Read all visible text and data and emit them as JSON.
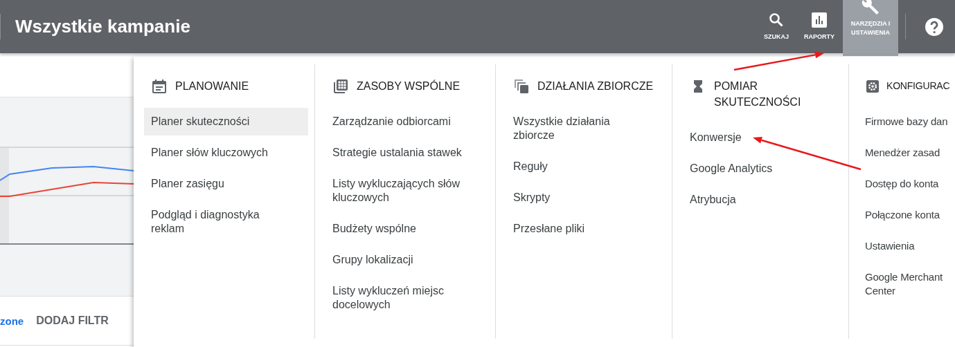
{
  "header": {
    "title": "Wszystkie kampanie",
    "actions": [
      {
        "kind": "search",
        "label": "SZUKAJ",
        "selected": false
      },
      {
        "kind": "reports",
        "label": "RAPORTY",
        "selected": false
      },
      {
        "kind": "tools",
        "label": "NARZĘDZIA I USTAWIENIA",
        "selected": true
      }
    ]
  },
  "filter_bar": {
    "link": "zone",
    "button": "DODAJ FILTR"
  },
  "menu": {
    "columns": [
      {
        "kind": "calendar",
        "heading": "PLANOWANIE",
        "items": [
          {
            "label": "Planer skuteczności",
            "selected": true
          },
          {
            "label": "Planer słów kluczowych",
            "selected": false
          },
          {
            "label": "Planer zasięgu",
            "selected": false
          },
          {
            "label": "Podgląd i diagnostyka reklam",
            "selected": false
          }
        ]
      },
      {
        "kind": "grid",
        "heading": "ZASOBY WSPÓLNE",
        "items": [
          {
            "label": "Zarządzanie odbiorcami",
            "selected": false
          },
          {
            "label": "Strategie ustalania stawek",
            "selected": false
          },
          {
            "label": "Listy wykluczających słów kluczowych",
            "selected": false
          },
          {
            "label": "Budżety wspólne",
            "selected": false
          },
          {
            "label": "Grupy lokalizacji",
            "selected": false
          },
          {
            "label": "Listy wykluczeń miejsc docelowych",
            "selected": false
          }
        ]
      },
      {
        "kind": "copies",
        "heading": "DZIAŁANIA ZBIORCZE",
        "items": [
          {
            "label": "Wszystkie działania zbiorcze",
            "selected": false
          },
          {
            "label": "Reguły",
            "selected": false
          },
          {
            "label": "Skrypty",
            "selected": false
          },
          {
            "label": "Przesłane pliki",
            "selected": false
          }
        ]
      },
      {
        "kind": "hourglass",
        "heading": "POMIAR SKUTECZNOŚCI",
        "items": [
          {
            "label": "Konwersje",
            "selected": false
          },
          {
            "label": "Google Analytics",
            "selected": false
          },
          {
            "label": "Atrybucja",
            "selected": false
          }
        ]
      },
      {
        "kind": "gear",
        "heading": "KONFIGURAC",
        "items": [
          {
            "label": "Firmowe bazy dan",
            "selected": false
          },
          {
            "label": "Menedżer zasad",
            "selected": false
          },
          {
            "label": "Dostęp do konta",
            "selected": false
          },
          {
            "label": "Połączone konta",
            "selected": false
          },
          {
            "label": "Ustawienia",
            "selected": false
          },
          {
            "label": "Google Merchant Center",
            "selected": false
          }
        ]
      }
    ]
  },
  "annotations": [
    {
      "kind": "arrow"
    },
    {
      "kind": "arrow"
    }
  ]
}
